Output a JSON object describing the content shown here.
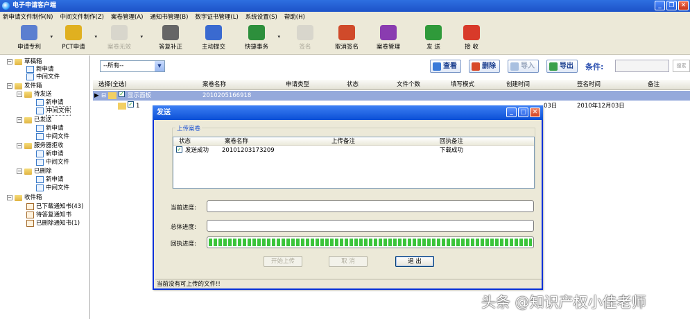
{
  "window": {
    "title": "电子申请客户端"
  },
  "menu": [
    "新申请文件制作(N)",
    "中间文件制作(Z)",
    "案卷管理(A)",
    "通知书管理(B)",
    "数字证书管理(L)",
    "系统设置(S)",
    "帮助(H)"
  ],
  "toolbar": [
    {
      "label": "申请专利",
      "color": "#5b7fd0",
      "disabled": false
    },
    {
      "label": "PCT申请",
      "color": "#e0b020",
      "disabled": false
    },
    {
      "label": "答复补正",
      "color": "#666666",
      "disabled": false
    },
    {
      "label": "主动提交",
      "color": "#3a6ad0",
      "disabled": false
    },
    {
      "label": "快捷事务",
      "color": "#2d8f3c",
      "disabled": false
    },
    {
      "label": "签名",
      "color": "#c8c6ba",
      "disabled": true
    },
    {
      "label": "取消签名",
      "color": "#d04a2a",
      "disabled": false
    },
    {
      "label": "案卷管理",
      "color": "#8a3cb0",
      "disabled": false
    },
    {
      "label": "发 送",
      "color": "#2f9a3a",
      "disabled": false
    },
    {
      "label": "接 收",
      "color": "#d83a2a",
      "disabled": false
    }
  ],
  "tree": {
    "draft": "草稿箱",
    "new_app": "新申请",
    "mid_file": "中间文件",
    "outbox": "发件箱",
    "pending": "待发送",
    "sent": "已发送",
    "rejected": "服务器拒收",
    "deleted": "已删除",
    "inbox": "收件箱",
    "downloaded": "已下载通知书(43)",
    "to_reply": "待答复通知书",
    "deleted_notices": "已删除通知书(1)"
  },
  "filter": {
    "select_value": "--所有--",
    "view": "查看",
    "delete": "删除",
    "import": "导入",
    "export": "导出",
    "condition": "条件:",
    "search": "搜索"
  },
  "grid": {
    "columns": [
      "选择(全选)",
      "案卷名称",
      "申请类型",
      "状态",
      "文件个数",
      "填写模式",
      "创建时间",
      "签名时间",
      "备注"
    ],
    "row1": {
      "select": "显示面板",
      "name": "2010205166918"
    },
    "row2": {
      "select": "1",
      "created": "03日",
      "signed": "2010年12月03日"
    }
  },
  "dialog": {
    "title": "发送",
    "group_label": "上传案卷",
    "list_columns": [
      "状态",
      "案卷名称",
      "上传备注",
      "回执备注"
    ],
    "list_row": {
      "status": "发送成功",
      "name": "20101203173209",
      "upload_note": "",
      "receipt_note": "下载成功"
    },
    "progress_current_label": "当前进度:",
    "progress_total_label": "总体进度:",
    "progress_receipt_label": "回执进度:",
    "progress_current": 0,
    "progress_total": 0,
    "progress_receipt": 1.0,
    "btn_start": "开始上传",
    "btn_cancel": "取 消",
    "btn_exit": "退 出",
    "status": "当前没有可上传的文件!!"
  },
  "watermark": "头条 @知识产权小佳老师"
}
